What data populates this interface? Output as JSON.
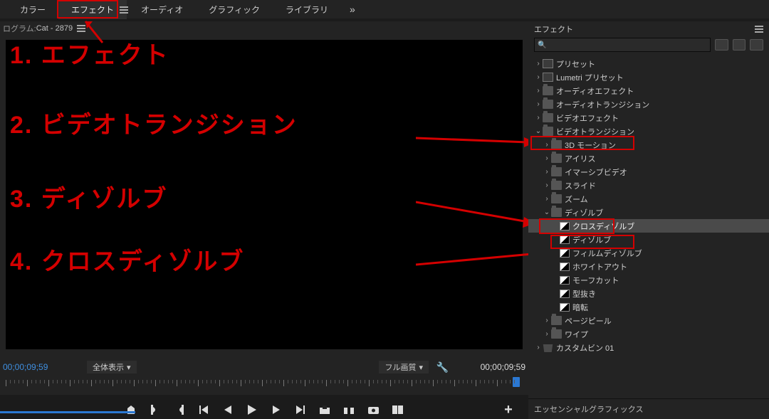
{
  "tabs": {
    "items": [
      "カラー",
      "エフェクト",
      "オーディオ",
      "グラフィック",
      "ライブラリ"
    ],
    "active_index": 1,
    "more_glyph": "»"
  },
  "program": {
    "panel_label_prefix": "ログラム: ",
    "clip_name": "Cat - 2879",
    "current_tc": "00;00;09;59",
    "duration_tc": "00;00;09;59",
    "fit_label": "全体表示",
    "full_label": "フル画質",
    "arrow_glyph": "▾",
    "wrench_glyph": "🔧",
    "transport_plus": "+"
  },
  "annotations": {
    "line1": "1. エフェクト",
    "line2": "2. ビデオトランジション",
    "line3": "3. ディゾルブ",
    "line4": "4. クロスディゾルブ"
  },
  "effects": {
    "panel_title": "エフェクト",
    "search_placeholder": "",
    "search_icon_glyph": "🔍",
    "tree": {
      "presets": "プリセット",
      "lumetri": "Lumetri プリセット",
      "audio_fx": "オーディオエフェクト",
      "audio_tr": "オーディオトランジション",
      "video_fx": "ビデオエフェクト",
      "video_tr": "ビデオトランジション",
      "vt_children": {
        "motion3d": "3D モーション",
        "iris": "アイリス",
        "immersive": "イマーシブビデオ",
        "slide": "スライド",
        "zoom": "ズーム",
        "dissolve": "ディゾルブ",
        "dissolve_children": {
          "cross": "クロスディゾルブ",
          "dip": "ディゾルブ",
          "film": "フィルムディゾルブ",
          "whiteout": "ホワイトアウト",
          "morph": "モーフカット",
          "additive": "型抜き",
          "blackout": "暗転"
        },
        "pagepeel": "ページピール",
        "wipe": "ワイプ"
      },
      "custom_bin": "カスタムビン 01"
    }
  },
  "essential_graphics": {
    "panel_title": "エッセンシャルグラフィックス"
  },
  "glyph": {
    "twisty_closed": "›",
    "twisty_open": "⌄"
  }
}
